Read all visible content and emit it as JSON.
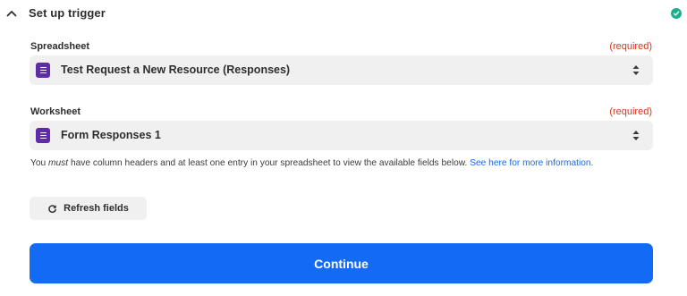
{
  "section": {
    "title": "Set up trigger",
    "toggle_icon": "chevron-up-icon",
    "status_icon": "check-circle-icon",
    "status_color": "#1dae8d"
  },
  "fields": {
    "spreadsheet": {
      "label": "Spreadsheet",
      "required_text": "(required)",
      "value": "Test Request a New Resource (Responses)",
      "icon": "google-sheets-icon"
    },
    "worksheet": {
      "label": "Worksheet",
      "required_text": "(required)",
      "value": "Form Responses 1",
      "icon": "google-sheets-icon"
    }
  },
  "hint": {
    "prefix": "You ",
    "emphasis": "must",
    "middle": " have column headers and at least one entry in your spreadsheet to view the available fields below. ",
    "link_text": "See here for more information."
  },
  "buttons": {
    "refresh_label": "Refresh fields",
    "refresh_icon": "refresh-icon",
    "continue_label": "Continue"
  },
  "colors": {
    "accent": "#136bf5",
    "required": "#d4361b",
    "sheets_icon": "#5e2ca5",
    "field_bg": "#f0f0f0"
  }
}
